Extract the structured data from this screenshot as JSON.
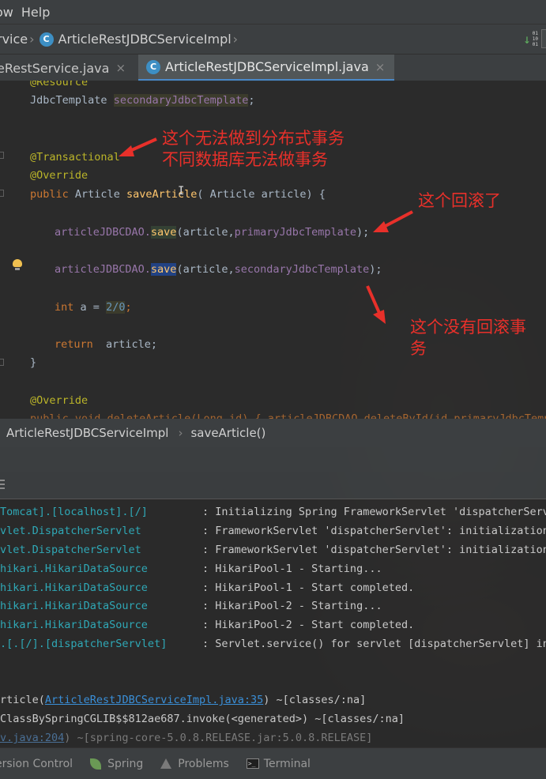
{
  "menu": {
    "items": [
      "ow",
      "Help"
    ]
  },
  "navbar": {
    "crumb_prev": "rvice",
    "crumb_current": "ArticleRestJDBCServiceImpl",
    "class_icon_letter": "C",
    "binary_icon": "binary-data-icon"
  },
  "tabs": [
    {
      "label": "eRestService.java",
      "close": "×",
      "active": false
    },
    {
      "label": "ArticleRestJDBCServiceImpl.java",
      "close": "×",
      "active": true,
      "icon_letter": "C"
    }
  ],
  "code": {
    "l1": "@Resource",
    "l2_type": "JdbcTemplate",
    "l2_field": "secondaryJdbcTemplate",
    "l2_end": ";",
    "l3": "@Transactional",
    "l4": "@Override",
    "l5_kw": "public",
    "l5_type": "Article",
    "l5_fn": "saveArticle",
    "l5_params": "( Article article) {",
    "l6_obj": "articleJDBCDAO.",
    "l6_fn": "save",
    "l6_open": "(article,",
    "l6_field": "primaryJdbcTemplate",
    "l6_end": ");",
    "l7_obj": "articleJDBCDAO.",
    "l7_fn": "save",
    "l7_open": "(article,",
    "l7_field": "secondaryJdbcTemplate",
    "l7_end": ");",
    "l8_kw": "int",
    "l8_var": "a",
    "l8_eq": " = ",
    "l8_val": "2/0",
    "l8_end": ";",
    "l9_kw": "return",
    "l9_val": "  article;",
    "l10": "}",
    "l11": "@Override",
    "l12": "public void deleteArticle(Long id) { articleJDBCDAO.deleteById(id,primaryJdbcTempl"
  },
  "annotations": {
    "note1_line1": "这个无法做到分布式事务",
    "note1_line2": "不同数据库无法做事务",
    "note2": "这个回滚了",
    "note3_line1": "这个没有回滚事",
    "note3_line2": "务",
    "color": "#e8302a"
  },
  "breadcrumb": {
    "class": "ArticleRestJDBCServiceImpl",
    "method": "saveArticle()"
  },
  "console": {
    "logs": [
      {
        "logger": "Tomcat].[localhost].[/]",
        "message": ": Initializing Spring FrameworkServlet 'dispatcherServlet'"
      },
      {
        "logger": "vlet.DispatcherServlet",
        "message": ": FrameworkServlet 'dispatcherServlet': initialization st"
      },
      {
        "logger": "vlet.DispatcherServlet",
        "message": ": FrameworkServlet 'dispatcherServlet': initialization co"
      },
      {
        "logger": "hikari.HikariDataSource",
        "message": ": HikariPool-1 - Starting..."
      },
      {
        "logger": "hikari.HikariDataSource",
        "message": ": HikariPool-1 - Start completed."
      },
      {
        "logger": "hikari.HikariDataSource",
        "message": ": HikariPool-2 - Starting..."
      },
      {
        "logger": "hikari.HikariDataSource",
        "message": ": HikariPool-2 - Start completed."
      },
      {
        "logger": ".[.[/].[dispatcherServlet]",
        "message": ": Servlet.service() for servlet [dispatcherServlet] in co"
      }
    ],
    "trace1_pre": "rticle(",
    "trace1_link": "ArticleRestJDBCServiceImpl.java:35",
    "trace1_post": ") ~[classes/:na]",
    "trace2": "ClassBySpringCGLIB$$812ae687.invoke(<generated>) ~[classes/:na]",
    "trace3_link": "v.java:204",
    "trace3_post": ") ~[spring-core-5.0.8.RELEASE.jar:5.0.8.RELEASE]"
  },
  "toolwindows": {
    "version_control": "ersion Control",
    "spring": "Spring",
    "problems": "Problems",
    "terminal": "Terminal",
    "terminal_glyph": ">_"
  }
}
